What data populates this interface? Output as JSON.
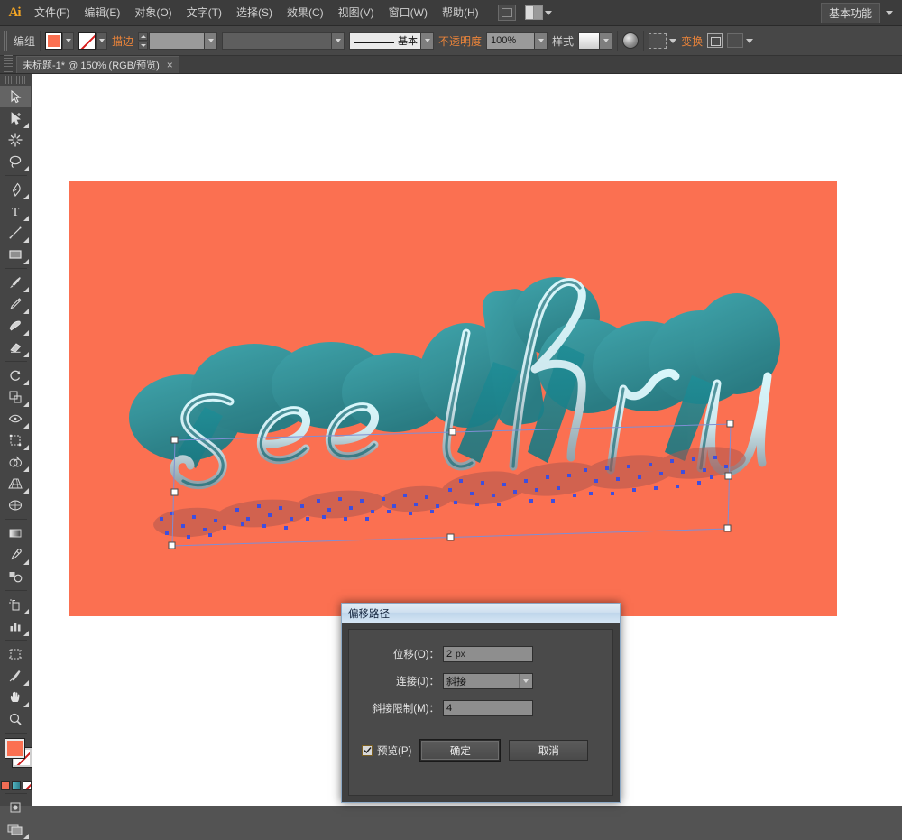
{
  "app": {
    "logo": "Ai",
    "workspace_label": "基本功能"
  },
  "menubar": {
    "items": [
      {
        "label": "文件(F)"
      },
      {
        "label": "编辑(E)"
      },
      {
        "label": "对象(O)"
      },
      {
        "label": "文字(T)"
      },
      {
        "label": "选择(S)"
      },
      {
        "label": "效果(C)"
      },
      {
        "label": "视图(V)"
      },
      {
        "label": "窗口(W)"
      },
      {
        "label": "帮助(H)"
      }
    ],
    "bridge_icon": "bridge-icon",
    "arrange_icon": "arrange-documents-icon"
  },
  "controlbar": {
    "selection_label": "编组",
    "fill_label": "fill-swatch",
    "fill_color": "#fb7051",
    "stroke_label": "stroke-swatch-none",
    "stroke_text": "描边",
    "stroke_weight_value": "",
    "width_profile_value": "",
    "brush_label": "基本",
    "opacity_label": "不透明度",
    "opacity_value": "100%",
    "style_label": "样式",
    "transform_label": "变换"
  },
  "tabbar": {
    "document_tab": "未标题-1* @ 150% (RGB/预览)",
    "close_glyph": "×"
  },
  "toolbar": {
    "tools": [
      {
        "name": "selection-tool",
        "active": true
      },
      {
        "name": "direct-selection-tool",
        "active": false
      },
      {
        "name": "magic-wand-tool",
        "active": false
      },
      {
        "name": "lasso-tool",
        "active": false
      },
      {
        "name": "pen-tool",
        "active": false
      },
      {
        "name": "type-tool",
        "active": false
      },
      {
        "name": "line-segment-tool",
        "active": false
      },
      {
        "name": "rectangle-tool",
        "active": false
      },
      {
        "name": "paintbrush-tool",
        "active": false
      },
      {
        "name": "pencil-tool",
        "active": false
      },
      {
        "name": "blob-brush-tool",
        "active": false
      },
      {
        "name": "eraser-tool",
        "active": false
      },
      {
        "name": "rotate-tool",
        "active": false
      },
      {
        "name": "scale-tool",
        "active": false
      },
      {
        "name": "width-tool",
        "active": false
      },
      {
        "name": "free-transform-tool",
        "active": false
      },
      {
        "name": "shape-builder-tool",
        "active": false
      },
      {
        "name": "perspective-grid-tool",
        "active": false
      },
      {
        "name": "mesh-tool",
        "active": false
      },
      {
        "name": "gradient-tool",
        "active": false
      },
      {
        "name": "eyedropper-tool",
        "active": false
      },
      {
        "name": "blend-tool",
        "active": false
      },
      {
        "name": "symbol-sprayer-tool",
        "active": false
      },
      {
        "name": "column-graph-tool",
        "active": false
      },
      {
        "name": "artboard-tool",
        "active": false
      },
      {
        "name": "slice-tool",
        "active": false
      },
      {
        "name": "hand-tool",
        "active": false
      },
      {
        "name": "zoom-tool",
        "active": false
      }
    ],
    "fill_color": "#fb7051",
    "stroke_color": "none",
    "color_mode_swatches": [
      "#f06c54",
      "#56b6c2",
      "#2b7f8c",
      "none"
    ]
  },
  "canvas": {
    "artboard_color": "#fb7051",
    "artwork_text": "see thru",
    "artwork_fill": "#2a9aa6",
    "artwork_outline": "#cfeff3",
    "selection_color": "#3f4ede"
  },
  "dialog": {
    "title": "偏移路径",
    "offset_label": "位移(O)：",
    "offset_value": "2",
    "offset_unit": "px",
    "join_label": "连接(J)：",
    "join_value": "斜接",
    "miter_label": "斜接限制(M)：",
    "miter_value": "4",
    "preview_label": "预览(P)",
    "preview_checked": true,
    "ok_label": "确定",
    "cancel_label": "取消"
  }
}
